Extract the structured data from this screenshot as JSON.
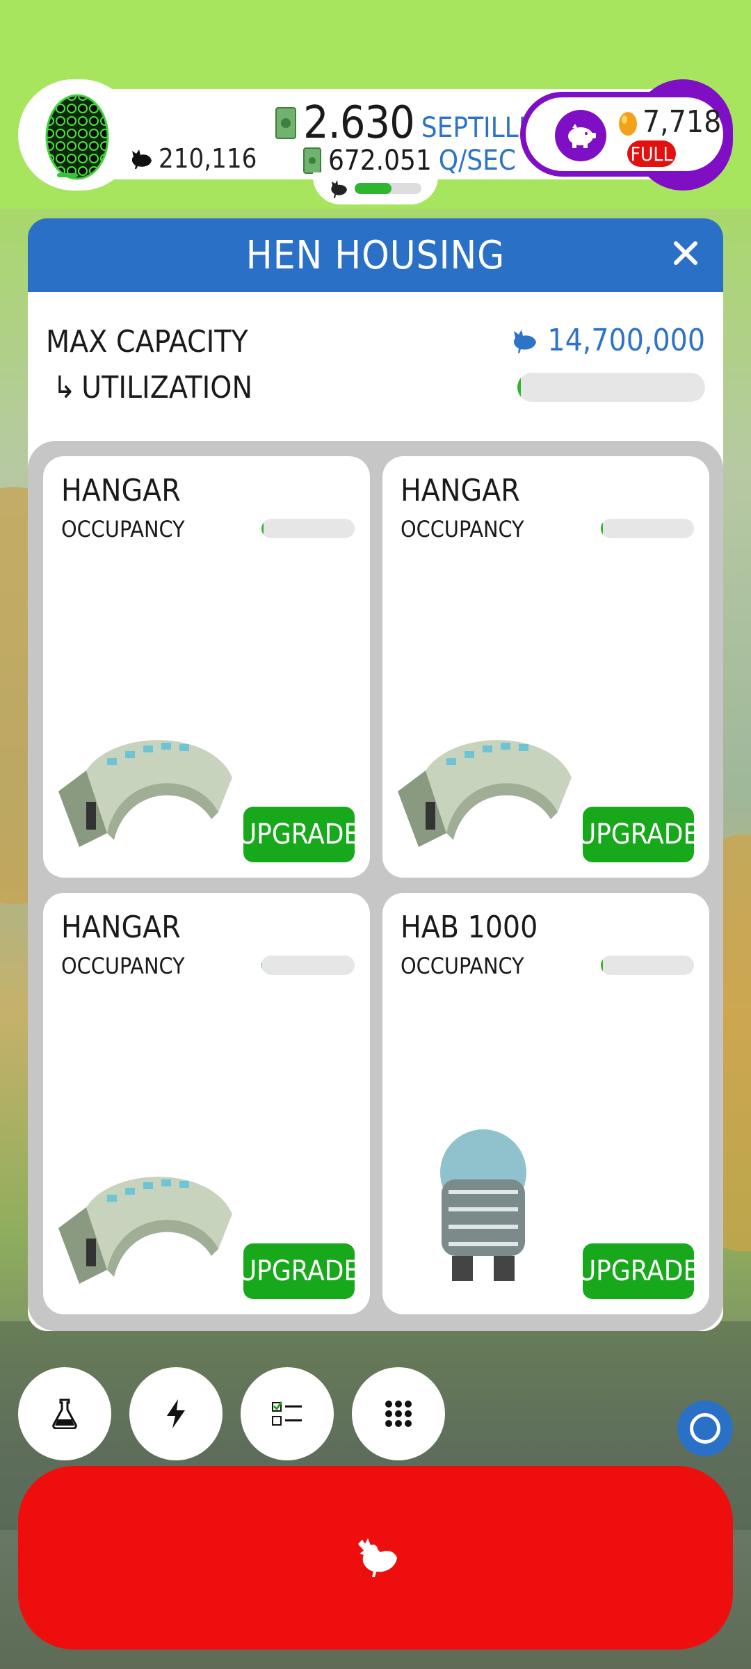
{
  "hud": {
    "hens": "210,116",
    "cash_amount": "2.630",
    "cash_unit": "SEPTILLION",
    "rate_amount": "672.051",
    "rate_unit": "Q/SEC",
    "progress": 0.55,
    "golden_eggs": "7,718",
    "full_badge": "FULL"
  },
  "modal": {
    "title": "HEN HOUSING",
    "max_capacity_label": "MAX CAPACITY",
    "max_capacity_value": "14,700,000",
    "utilization_arrow": "↳",
    "utilization_label": "UTILIZATION",
    "utilization": 0.02,
    "habs": [
      {
        "name": "HANGAR",
        "occupancy_label": "OCCUPANCY",
        "occupancy": 0.02,
        "upgrade_label": "UPGRADE"
      },
      {
        "name": "HANGAR",
        "occupancy_label": "OCCUPANCY",
        "occupancy": 0.02,
        "upgrade_label": "UPGRADE"
      },
      {
        "name": "HANGAR",
        "occupancy_label": "OCCUPANCY",
        "occupancy": 0.01,
        "upgrade_label": "UPGRADE"
      },
      {
        "name": "HAB 1000",
        "occupancy_label": "OCCUPANCY",
        "occupancy": 0.02,
        "upgrade_label": "UPGRADE"
      }
    ]
  },
  "colors": {
    "accent_blue": "#2b70c7",
    "upgrade_green": "#17a91b",
    "hatch_red": "#ef0e0e",
    "egg_purple": "#7f0fc4"
  },
  "icons": {
    "research": "flask-icon",
    "boost": "lightning-icon",
    "missions": "checklist-icon",
    "menu": "grid-icon",
    "hatch": "chicken-icon"
  }
}
